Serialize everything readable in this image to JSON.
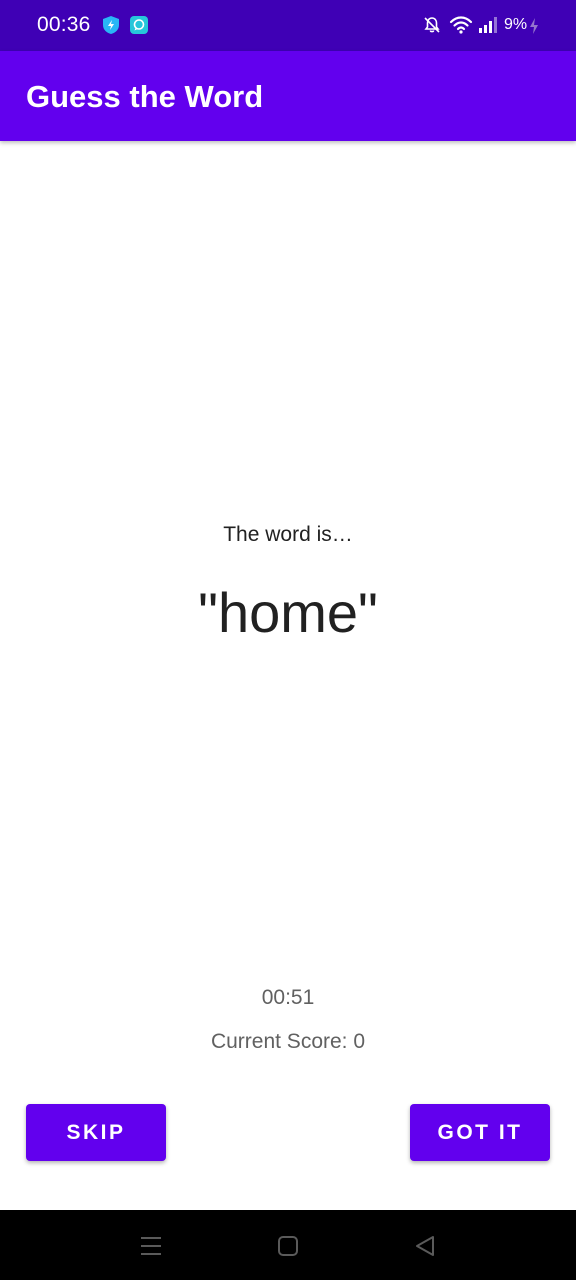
{
  "status_bar": {
    "time": "00:36",
    "battery": "9%",
    "icons": [
      "shield-icon",
      "chat-icon",
      "bell-off-icon",
      "wifi-icon",
      "signal-icon",
      "battery-charging-icon"
    ],
    "background": "#3f00b5"
  },
  "app_bar": {
    "title": "Guess the Word",
    "background": "#6200ee"
  },
  "game": {
    "intro": "The word is…",
    "word": "\"home\"",
    "timer": "00:51",
    "score_label": "Current Score:",
    "score_value": "0"
  },
  "buttons": {
    "skip": "SKIP",
    "got_it": "GOT IT",
    "color": "#6200ee"
  },
  "nav_bar": {
    "icons": [
      "menu-icon",
      "home-square-icon",
      "back-triangle-icon"
    ]
  }
}
